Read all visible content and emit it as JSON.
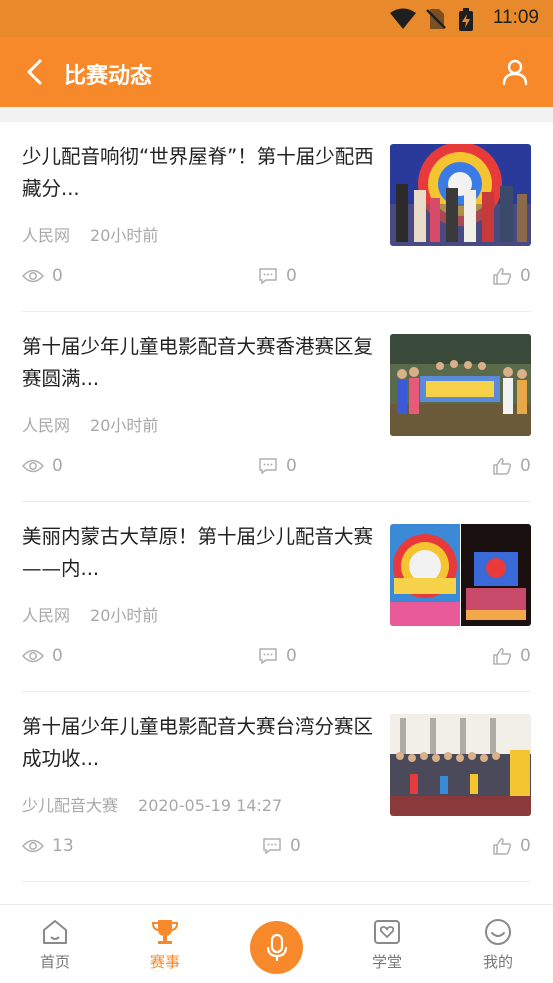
{
  "status_bar": {
    "time": "11:09"
  },
  "header": {
    "title": "比赛动态"
  },
  "articles": [
    {
      "title": "少儿配音响彻“世界屋脊”！第十届少配西藏分...",
      "source": "人民网",
      "time": "20小时前",
      "views": "0",
      "comments": "0",
      "likes": "0"
    },
    {
      "title": "第十届少年儿童电影配音大赛香港赛区复赛圆满...",
      "source": "人民网",
      "time": "20小时前",
      "views": "0",
      "comments": "0",
      "likes": "0"
    },
    {
      "title": "美丽内蒙古大草原！第十届少儿配音大赛——内...",
      "source": "人民网",
      "time": "20小时前",
      "views": "0",
      "comments": "0",
      "likes": "0"
    },
    {
      "title": "第十届少年儿童电影配音大赛台湾分赛区成功收...",
      "source": "少儿配音大赛",
      "time": "2020-05-19 14:27",
      "views": "13",
      "comments": "0",
      "likes": "0"
    }
  ],
  "tabs": [
    {
      "label": "首页",
      "icon": "home-icon"
    },
    {
      "label": "赛事",
      "icon": "trophy-icon",
      "active": true
    },
    {
      "label": "",
      "icon": "microphone-icon"
    },
    {
      "label": "学堂",
      "icon": "heart-box-icon"
    },
    {
      "label": "我的",
      "icon": "smile-icon"
    }
  ],
  "colors": {
    "primary": "#f7892b",
    "status_bar": "#e88a2b",
    "muted_text": "#a8a8a8"
  }
}
